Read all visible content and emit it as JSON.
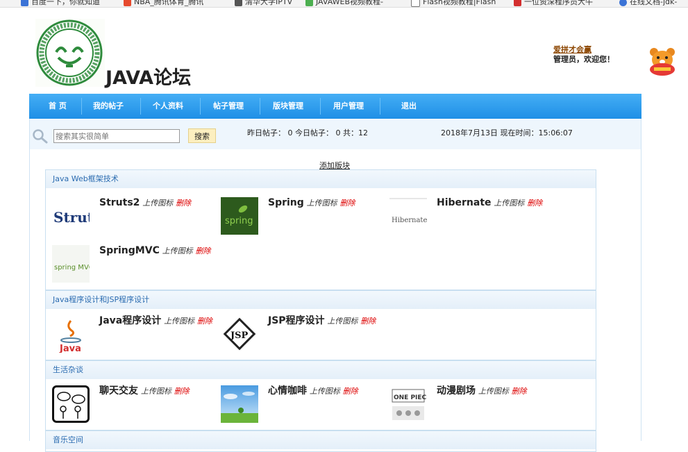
{
  "bookmarks": [
    {
      "label": "百度一下，你就知道",
      "color": "#3b73d6"
    },
    {
      "label": "NBA_腾讯体育_腾讯",
      "color": "#e64a2e"
    },
    {
      "label": "清华大学IPTV",
      "color": "#555555"
    },
    {
      "label": "JAVAWEB视频教程-",
      "color": "#4caf50"
    },
    {
      "label": "Flash视频教程|Flash",
      "color": "#777777"
    },
    {
      "label": "一位资深程序员大牛",
      "color": "#d32f2f"
    },
    {
      "label": "在线文档-jdk-",
      "color": "#3b73d6"
    }
  ],
  "header": {
    "site_title": "JAVA论坛",
    "user_name": "爱拼才会赢",
    "welcome": "管理员，欢迎您！"
  },
  "nav": [
    "首 页",
    "我的帖子",
    "个人资料",
    "帖子管理",
    "版块管理",
    "用户管理",
    "退出"
  ],
  "search": {
    "placeholder": "搜索其实很简单",
    "button": "搜索",
    "stats": "昨日帖子： 0 今日帖子： 0   共：12",
    "datetime": "2018年7月13日 现在时间：15:06:07"
  },
  "main": {
    "add_board": "添加版块",
    "upload_label": "上传图标",
    "delete_label": "删除",
    "categories": [
      {
        "title": "Java Web框架技术",
        "boards": [
          "Struts2",
          "Spring",
          "Hibernate",
          "SpringMVC"
        ]
      },
      {
        "title": "Java程序设计和JSP程序设计",
        "boards": [
          "Java程序设计",
          "JSP程序设计"
        ]
      },
      {
        "title": "生活杂谈",
        "boards": [
          "聊天交友",
          "心情咖啡",
          "动漫剧场"
        ]
      },
      {
        "title": "音乐空间",
        "boards": []
      }
    ]
  },
  "colors": {
    "nav": "#2f9ff0",
    "delete": "#dd0000",
    "category": "#2a6bb0"
  }
}
